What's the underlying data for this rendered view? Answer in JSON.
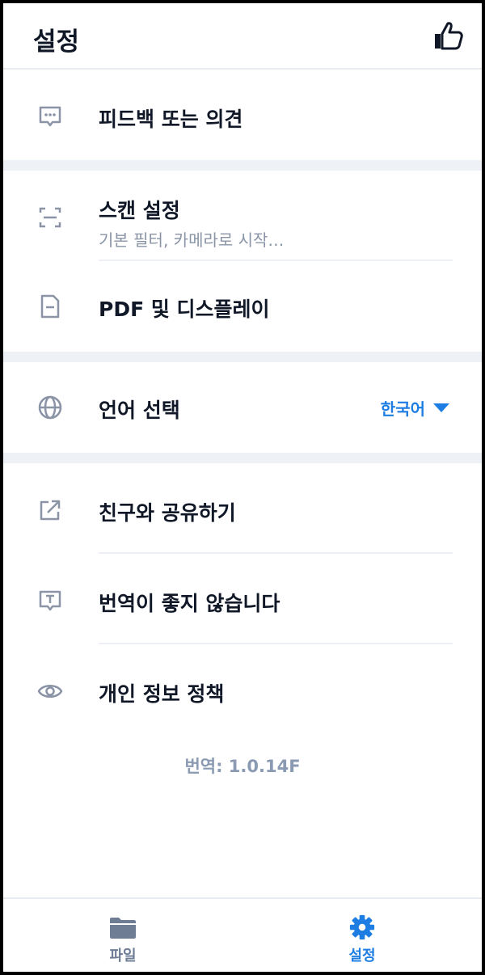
{
  "header": {
    "title": "설정",
    "like_icon": "thumbs-up-icon"
  },
  "groups": {
    "feedback": {
      "label": "피드백 또는 의견",
      "icon": "chat-bubble-icon"
    },
    "scan": {
      "label": "스캔 설정",
      "sublabel": "기본 필터, 카메라로 시작…",
      "icon": "scan-frame-icon"
    },
    "pdf": {
      "label": "PDF 및 디스플레이",
      "icon": "document-icon"
    },
    "language": {
      "label": "언어 선택",
      "value": "한국어",
      "icon": "globe-icon"
    },
    "share": {
      "label": "친구와 공유하기",
      "icon": "share-icon"
    },
    "bad_translation": {
      "label": "번역이 좋지 않습니다",
      "icon": "translate-feedback-icon"
    },
    "privacy": {
      "label": "개인 정보 정책",
      "icon": "eye-icon"
    }
  },
  "version": "번역: 1.0.14F",
  "tabs": [
    {
      "label": "파일",
      "icon": "folder-icon",
      "active": false
    },
    {
      "label": "설정",
      "icon": "gear-icon",
      "active": true
    }
  ],
  "colors": {
    "accent": "#1e7de3",
    "icon_gray": "#8a94a6",
    "text_dark": "#101828",
    "separator": "#eef1f6"
  }
}
